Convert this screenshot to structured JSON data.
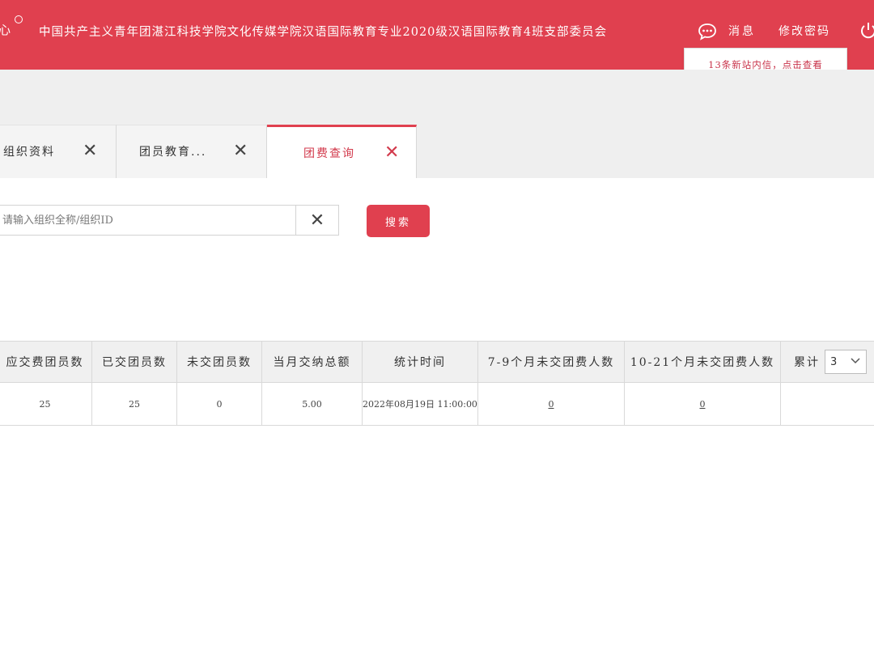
{
  "header": {
    "logo_text": "心",
    "org_title": "中国共产主义青年团湛江科技学院文化传媒学院汉语国际教育专业2020级汉语国际教育4班支部委员会",
    "messages_label": "消息",
    "change_password_label": "修改密码",
    "icons": [
      "message-icon",
      "power-icon"
    ]
  },
  "tooltip": {
    "text": "13条新站内信，点击查看"
  },
  "tabs": [
    {
      "label": "组织资料",
      "active": false
    },
    {
      "label": "团员教育...",
      "active": false
    },
    {
      "label": "团费查询",
      "active": true
    }
  ],
  "search": {
    "placeholder": "请输入组织全称/组织ID",
    "value": "",
    "button_label": "搜索"
  },
  "table": {
    "headers": [
      "应交费团员数",
      "已交团员数",
      "未交团员数",
      "当月交纳总额",
      "统计时间",
      "7-9个月未交团费人数",
      "10-21个月未交团费人数",
      "累计"
    ],
    "rows": [
      [
        "25",
        "25",
        "0",
        "5.00",
        "2022年08月19日 11:00:00",
        "0",
        "0",
        ""
      ]
    ],
    "cumulative_select": "3"
  },
  "colors": {
    "brand": "#e0404f",
    "band": "#efefef"
  }
}
